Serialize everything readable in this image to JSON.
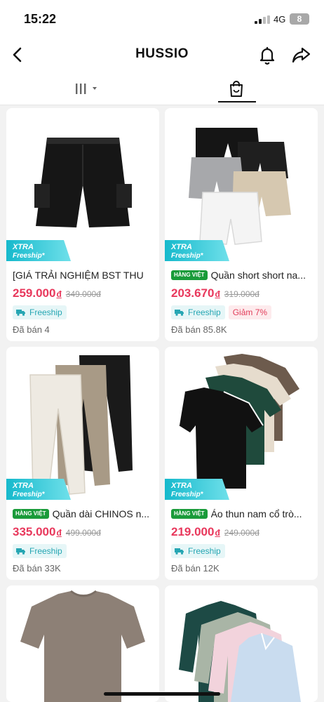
{
  "status": {
    "time": "15:22",
    "network": "4G",
    "battery": "8"
  },
  "header": {
    "title": "HUSSIO"
  },
  "badges": {
    "xtra_line1": "XTRA",
    "xtra_line2": "Freeship*",
    "hang_viet": "HÀNG VIỆT"
  },
  "colors": {
    "price": "#e8385c",
    "xtra": "#3ec6d6",
    "freeship": "#26a6b3",
    "hang_viet": "#1a9b3a",
    "discount": "#e23d5a"
  },
  "products": [
    {
      "title": "[GIÁ TRẢI NGHIỆM BST THU",
      "has_hang_viet": false,
      "price": "259.000",
      "currency": "đ",
      "old_price": "349.000đ",
      "freeship": "Freeship",
      "discount": "",
      "sold": "Đã bán 4",
      "image": "black-cargo-shorts"
    },
    {
      "title": "Quần short short na...",
      "has_hang_viet": true,
      "price": "203.670",
      "currency": "đ",
      "old_price": "319.000đ",
      "freeship": "Freeship",
      "discount": "Giảm 7%",
      "sold": "Đã bán 85.8K",
      "image": "shorts-bundle"
    },
    {
      "title": "Quần dài CHINOS n...",
      "has_hang_viet": true,
      "price": "335.000",
      "currency": "đ",
      "old_price": "499.000đ",
      "freeship": "Freeship",
      "discount": "",
      "sold": "Đã bán 33K",
      "image": "chinos-trio"
    },
    {
      "title": "Áo thun nam cổ trò...",
      "has_hang_viet": true,
      "price": "219.000",
      "currency": "đ",
      "old_price": "249.000đ",
      "freeship": "Freeship",
      "discount": "",
      "sold": "Đã bán 12K",
      "image": "tshirt-stack"
    },
    {
      "image": "brown-tshirt"
    },
    {
      "image": "shirt-stack"
    }
  ]
}
